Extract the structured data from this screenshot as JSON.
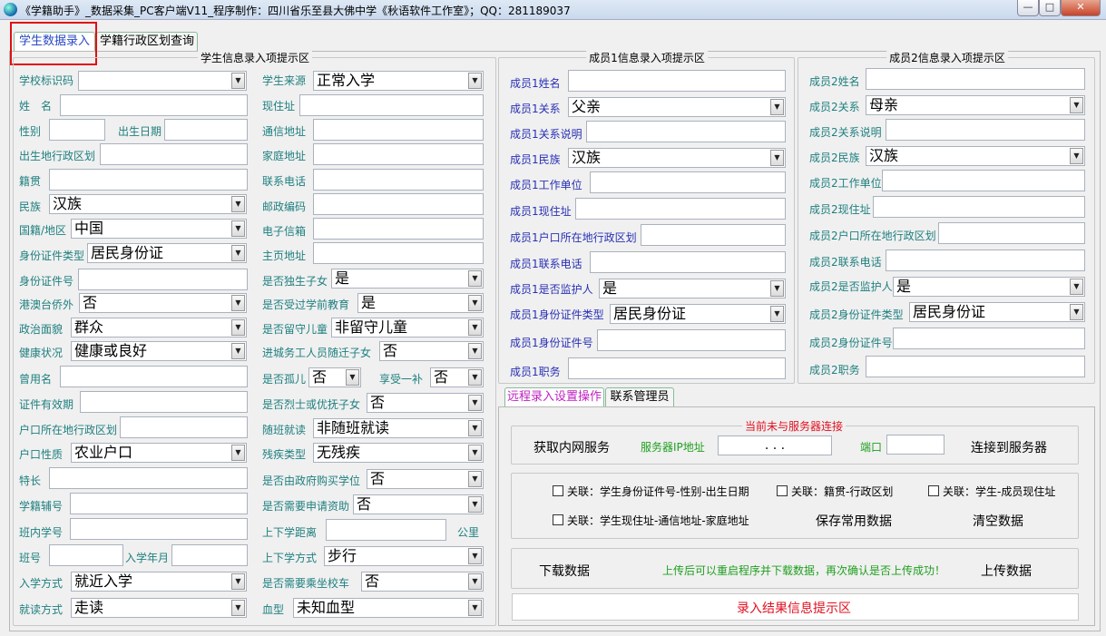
{
  "window": {
    "title": "《学籍助手》_数据采集_PC客户端V11_程序制作：四川省乐至县大佛中学《秋语软件工作室》；QQ：281189037",
    "min": "—",
    "max": "□",
    "close": "✕"
  },
  "tabs": [
    "学生数据录入",
    "学籍行政区划查询"
  ],
  "student": {
    "title": "学生信息录入项提示区",
    "school_id": "学校标识码",
    "name": "姓　名",
    "gender": "性别",
    "birth": "出生日期",
    "birthplace": "出生地行政区划",
    "native": "籍贯",
    "ethnic": "民族",
    "ethnic_val": "汉族",
    "nation": "国籍/地区",
    "nation_val": "中国",
    "idtype": "身份证件类型",
    "idtype_val": "居民身份证",
    "idno": "身份证件号",
    "overseas": "港澳台侨外",
    "overseas_val": "否",
    "political": "政治面貌",
    "political_val": "群众",
    "health": "健康状况",
    "health_val": "健康或良好",
    "formername": "曾用名",
    "idvalid": "证件有效期",
    "hukou_region": "户口所在地行政区划",
    "hukou_type": "户口性质",
    "hukou_type_val": "农业户口",
    "specialty": "特长",
    "aux_no": "学籍辅号",
    "class_no": "班内学号",
    "class": "班号",
    "enroll_year": "入学年月",
    "enroll_way": "入学方式",
    "enroll_way_val": "就近入学",
    "study_way": "就读方式",
    "study_way_val": "走读",
    "source": "学生来源",
    "source_val": "正常入学",
    "address": "现住址",
    "mail_addr": "通信地址",
    "home_addr": "家庭地址",
    "phone": "联系电话",
    "zip": "邮政编码",
    "email": "电子信箱",
    "homepage": "主页地址",
    "only_child": "是否独生子女",
    "only_child_val": "是",
    "preschool": "是否受过学前教育",
    "preschool_val": "是",
    "left_behind": "是否留守儿童",
    "left_behind_val": "非留守儿童",
    "migrant": "进城务工人员随迁子女",
    "migrant_val": "否",
    "orphan": "是否孤儿",
    "orphan_val": "否",
    "subsidy": "享受一补",
    "subsidy_val": "否",
    "martyr": "是否烈士或优抚子女",
    "martyr_val": "否",
    "regular": "随班就读",
    "regular_val": "非随班就读",
    "disability": "残疾类型",
    "disability_val": "无残疾",
    "gov_degree": "是否由政府购买学位",
    "gov_degree_val": "否",
    "aid": "是否需要申请资助",
    "aid_val": "否",
    "distance": "上下学距离",
    "distance_unit": "公里",
    "commute": "上下学方式",
    "commute_val": "步行",
    "bus": "是否需要乘坐校车",
    "bus_val": "否",
    "blood": "血型",
    "blood_val": "未知血型"
  },
  "m1": {
    "title": "成员1信息录入项提示区",
    "name": "成员1姓名",
    "rel": "成员1关系",
    "rel_val": "父亲",
    "rel_note": "成员1关系说明",
    "ethnic": "成员1民族",
    "ethnic_val": "汉族",
    "work": "成员1工作单位",
    "addr": "成员1现住址",
    "hukou": "成员1户口所在地行政区划",
    "phone": "成员1联系电话",
    "guardian": "成员1是否监护人",
    "guardian_val": "是",
    "idtype": "成员1身份证件类型",
    "idtype_val": "居民身份证",
    "idno": "成员1身份证件号",
    "job": "成员1职务"
  },
  "m2": {
    "title": "成员2信息录入项提示区",
    "name": "成员2姓名",
    "rel": "成员2关系",
    "rel_val": "母亲",
    "rel_note": "成员2关系说明",
    "ethnic": "成员2民族",
    "ethnic_val": "汉族",
    "work": "成员2工作单位",
    "addr": "成员2现住址",
    "hukou": "成员2户口所在地行政区划",
    "phone": "成员2联系电话",
    "guardian": "成员2是否监护人",
    "guardian_val": "是",
    "idtype": "成员2身份证件类型",
    "idtype_val": "居民身份证",
    "idno": "成员2身份证件号",
    "job": "成员2职务"
  },
  "subtabs": [
    "远程录入设置操作",
    "联系管理员"
  ],
  "remote": {
    "conn_status": "当前未与服务器连接",
    "get_lan": "获取内网服务",
    "server_ip": "服务器IP地址",
    "ip_dots": ".    .    .",
    "port": "端口",
    "connect": "连接到服务器",
    "link1": "关联：学生身份证件号-性别-出生日期",
    "link2": "关联：籍贯-行政区划",
    "link3": "关联：学生-成员现住址",
    "link4": "关联：学生现住址-通信地址-家庭地址",
    "save": "保存常用数据",
    "clear": "清空数据",
    "download": "下载数据",
    "hint": "上传后可以重启程序并下载数据，再次确认是否上传成功！",
    "upload": "上传数据",
    "result": "录入结果信息提示区"
  }
}
